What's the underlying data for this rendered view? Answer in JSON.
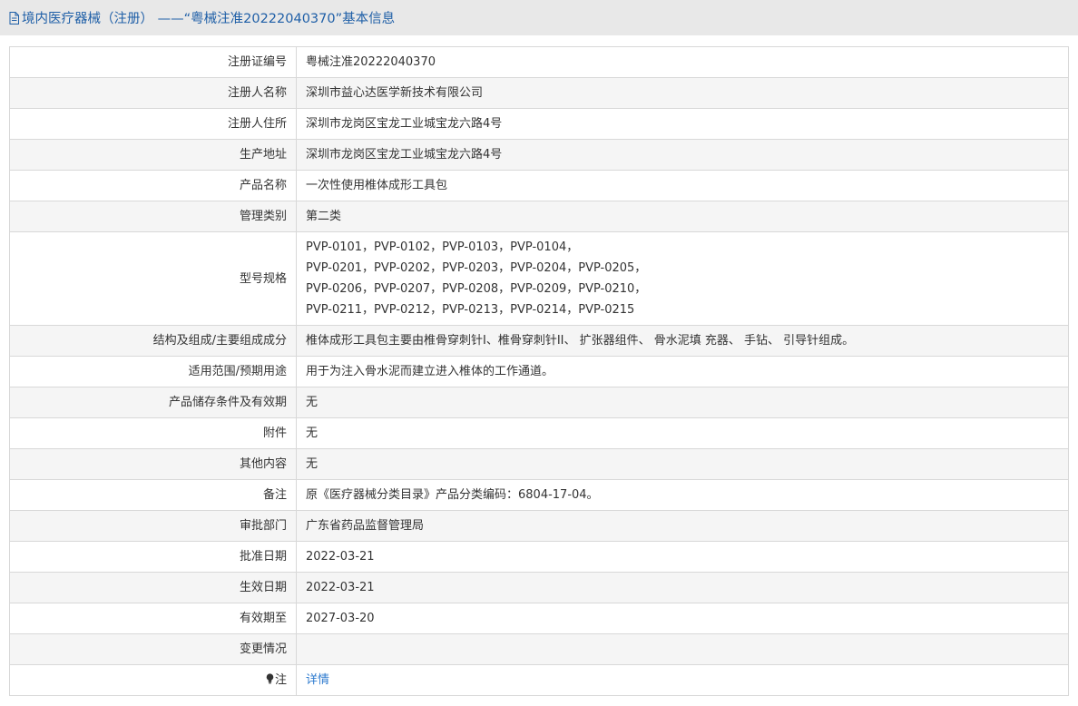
{
  "header": {
    "title": "境内医疗器械（注册） ——“粤械注准20222040370”基本信息"
  },
  "rows": [
    {
      "label": "注册证编号",
      "value": "粤械注准20222040370"
    },
    {
      "label": "注册人名称",
      "value": "深圳市益心达医学新技术有限公司"
    },
    {
      "label": "注册人住所",
      "value": "深圳市龙岗区宝龙工业城宝龙六路4号"
    },
    {
      "label": "生产地址",
      "value": "深圳市龙岗区宝龙工业城宝龙六路4号"
    },
    {
      "label": "产品名称",
      "value": "一次性使用椎体成形工具包"
    },
    {
      "label": "管理类别",
      "value": "第二类"
    }
  ],
  "spec": {
    "label": "型号规格",
    "lines": [
      "PVP-0101，PVP-0102，PVP-0103，PVP-0104，",
      "PVP-0201，PVP-0202，PVP-0203，PVP-0204，PVP-0205，",
      "PVP-0206，PVP-0207，PVP-0208，PVP-0209，PVP-0210，",
      "PVP-0211，PVP-0212，PVP-0213，PVP-0214，PVP-0215"
    ]
  },
  "rows2": [
    {
      "label": "结构及组成/主要组成成分",
      "value": "椎体成形工具包主要由椎骨穿刺针I、椎骨穿刺针II、 扩张器组件、 骨水泥填 充器、 手钻、 引导针组成。"
    },
    {
      "label": "适用范围/预期用途",
      "value": "用于为注入骨水泥而建立进入椎体的工作通道。"
    },
    {
      "label": "产品储存条件及有效期",
      "value": "无"
    },
    {
      "label": "附件",
      "value": "无"
    },
    {
      "label": "其他内容",
      "value": "无"
    },
    {
      "label": "备注",
      "value": "原《医疗器械分类目录》产品分类编码：6804-17-04。"
    },
    {
      "label": "审批部门",
      "value": "广东省药品监督管理局"
    },
    {
      "label": "批准日期",
      "value": "2022-03-21"
    },
    {
      "label": "生效日期",
      "value": "2022-03-21"
    },
    {
      "label": "有效期至",
      "value": "2027-03-20"
    },
    {
      "label": "变更情况",
      "value": ""
    }
  ],
  "note": {
    "label": "注",
    "link_text": "详情",
    "icon": "lightbulb-icon"
  },
  "colors": {
    "title": "#1f5fa7",
    "link": "#2e7bcf",
    "header_bg": "#e8e8e8",
    "border": "#d8d8d8",
    "stripe": "#f5f5f5"
  }
}
